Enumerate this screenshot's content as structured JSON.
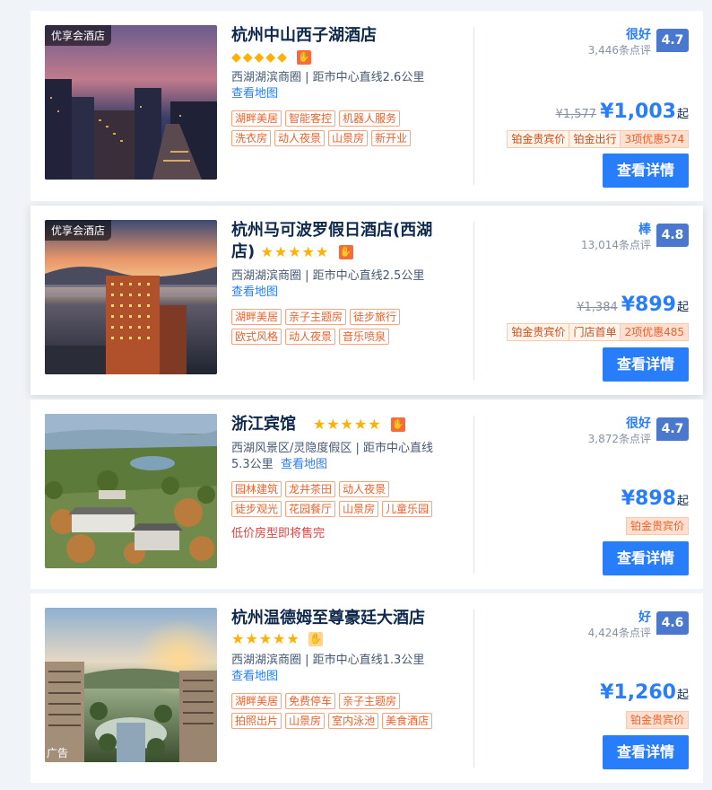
{
  "hotels": [
    {
      "badge": "优享会酒店",
      "name": "杭州中山西子湖酒店",
      "stars": "◆◆◆◆◆",
      "location": "西湖湖滨商圈 | 距市中心直线2.6公里",
      "map_link": "查看地图",
      "tags": [
        "湖畔美居",
        "智能客控",
        "机器人服务",
        "洗衣房",
        "动人夜景",
        "山景房",
        "新开业"
      ],
      "rating_word": "很好",
      "reviews": "3,446条点评",
      "score": "4.7",
      "old_price": "¥1,577",
      "price": "¥1,003",
      "price_suffix": "起",
      "promos": [
        "铂金贵宾价",
        "铂金出行",
        "3项优惠574"
      ],
      "button": "查看详情"
    },
    {
      "badge": "优享会酒店",
      "name": "杭州马可波罗假日酒店(西湖店)",
      "stars": "★★★★★",
      "location": "西湖湖滨商圈 | 距市中心直线2.5公里",
      "map_link": "查看地图",
      "tags": [
        "湖畔美居",
        "亲子主题房",
        "徒步旅行",
        "欧式风格",
        "动人夜景",
        "音乐喷泉"
      ],
      "rating_word": "棒",
      "reviews": "13,014条点评",
      "score": "4.8",
      "old_price": "¥1,384",
      "price": "¥899",
      "price_suffix": "起",
      "promos": [
        "铂金贵宾价",
        "门店首单",
        "2项优惠485"
      ],
      "button": "查看详情"
    },
    {
      "name": "浙江宾馆",
      "stars": "★★★★★",
      "location": "西湖风景区/灵隐度假区 | 距市中心直线5.3公里",
      "map_link": "查看地图",
      "tags": [
        "园林建筑",
        "龙井茶田",
        "动人夜景",
        "徒步观光",
        "花园餐厅",
        "山景房",
        "儿童乐园"
      ],
      "warning": "低价房型即将售完",
      "rating_word": "很好",
      "reviews": "3,872条点评",
      "score": "4.7",
      "price": "¥898",
      "price_suffix": "起",
      "promos": [
        "铂金贵宾价"
      ],
      "button": "查看详情"
    },
    {
      "ad": "广告",
      "name": "杭州温德姆至尊豪廷大酒店",
      "stars": "★★★★★",
      "location": "西湖湖滨商圈 | 距市中心直线1.3公里",
      "map_link": "查看地图",
      "tags": [
        "湖畔美居",
        "免费停车",
        "亲子主题房",
        "拍照出片",
        "山景房",
        "室内泳池",
        "美食酒店"
      ],
      "rating_word": "好",
      "reviews": "4,424条点评",
      "score": "4.6",
      "price": "¥1,260",
      "price_suffix": "起",
      "promos": [
        "铂金贵宾价"
      ],
      "button": "查看详情"
    }
  ],
  "colors": {
    "accent": "#287dfa",
    "score_bg": "#4978ce",
    "tag": "#e8622e",
    "warning": "#e24040"
  },
  "icons": {
    "thumb": "thumbs-up-icon"
  }
}
